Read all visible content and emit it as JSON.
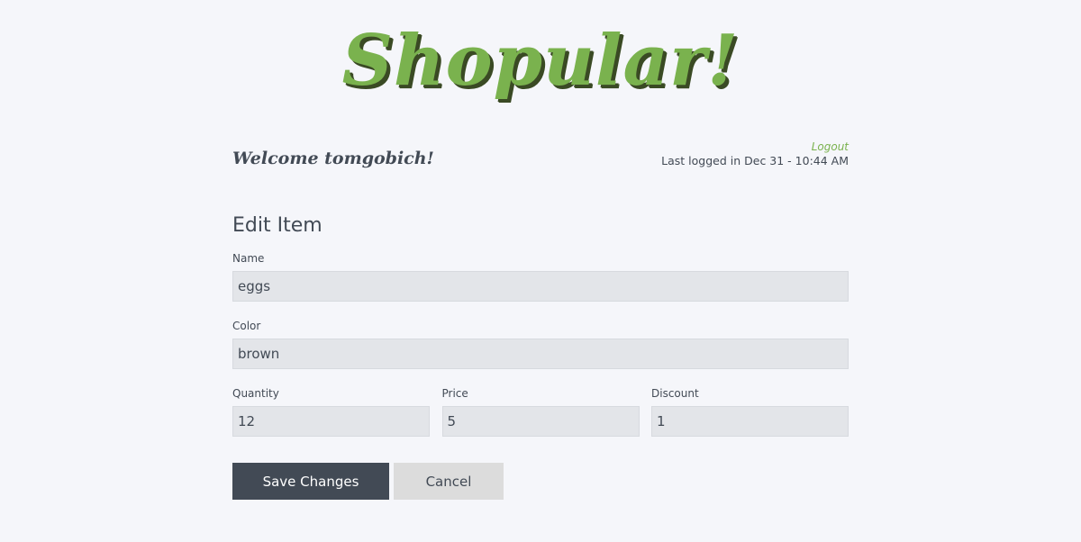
{
  "header": {
    "logo_text": "Shopular!",
    "welcome_text": "Welcome tomgobich!",
    "logout_label": "Logout",
    "last_login_text": "Last logged in Dec 31 - 10:44 AM"
  },
  "form": {
    "title": "Edit Item",
    "name": {
      "label": "Name",
      "value": "eggs"
    },
    "color": {
      "label": "Color",
      "value": "brown"
    },
    "quantity": {
      "label": "Quantity",
      "value": "12"
    },
    "price": {
      "label": "Price",
      "value": "5"
    },
    "discount": {
      "label": "Discount",
      "value": "1"
    }
  },
  "actions": {
    "save_label": "Save Changes",
    "cancel_label": "Cancel"
  },
  "colors": {
    "accent": "#7ab24e",
    "primary_dark": "#424a55",
    "background": "#f5f6fa",
    "input_bg": "#e3e5e9"
  }
}
